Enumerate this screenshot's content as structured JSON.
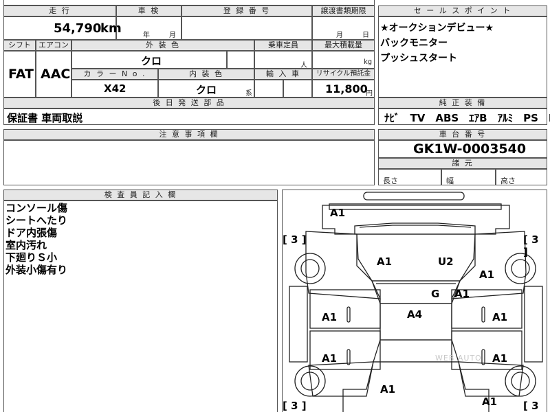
{
  "headers": {
    "mileage": "走 行",
    "inspection": "車 検",
    "registration": "登 録 番 号",
    "transfer_deadline": "譲渡書類期限",
    "sales_point": "セ ー ル ス ポ イ ン ト",
    "shift": "シフト",
    "aircon": "エアコン",
    "exterior_color": "外 装 色",
    "capacity": "乗車定員",
    "max_load": "最大積載量",
    "color_no": "カ ラ ー N o .",
    "interior_color": "内 装 色",
    "import": "輸 入 車",
    "recycle": "リサイクル預託金",
    "later_parts": "後 日 発 送 部 品",
    "equipment": "純 正 装 備",
    "notes": "注 意 事 項 欄",
    "chassis_no": "車 台 番 号",
    "specs": "諸 元",
    "inspector": "検 査 員 記 入 欄"
  },
  "values": {
    "mileage_value": "54,790",
    "mileage_unit": "km",
    "year_unit": "年",
    "month_unit": "月",
    "transfer_month": "月",
    "transfer_day": "日",
    "shift": "FAT",
    "aircon": "AAC",
    "exterior_color": "クロ",
    "capacity_unit": "人",
    "load_unit": "kg",
    "color_no": "X42",
    "interior_color": "クロ",
    "interior_suffix": "系",
    "recycle_amount": "11,800",
    "recycle_unit": "円",
    "later_parts": "保証書 車両取説",
    "chassis_no": "GK1W-0003540",
    "length_label": "長さ",
    "width_label": "幅",
    "height_label": "高さ"
  },
  "sales_points": [
    "★オークションデビュー★",
    "バックモニター",
    "プッシュスタート"
  ],
  "equipment_items": "ﾅﾋﾞ　TV　ABS　ｴｱB　ｱﾙﾐ　PS　PW",
  "inspector_notes": [
    "コンソール傷",
    "シートへたり",
    "ドア内張傷",
    "室内汚れ",
    "下廻りＳ小",
    "外装小傷有り"
  ],
  "diagram": {
    "marks": {
      "front_bumper": "A1",
      "hood_left": "A1",
      "hood_right": "U2",
      "fender_right": "A1",
      "windshield": "G",
      "windshield_mark": "A1",
      "roof": "A4",
      "front_door_left": "A1",
      "front_door_right": "A1",
      "rear_door_left": "A1",
      "rear_door_right": "A1",
      "trunk": "A1",
      "rear_right": "A1"
    },
    "tire_tl": "3",
    "tire_tr": "3",
    "tire_bl": "3",
    "tire_br": "3",
    "watermark": "WEB AUTO"
  }
}
